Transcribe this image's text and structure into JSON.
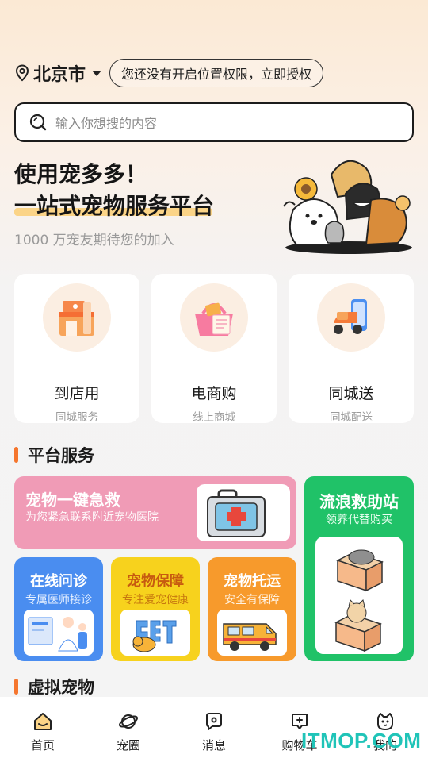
{
  "location": {
    "city": "北京市",
    "permission_notice": "您还没有开启位置权限，立即授权"
  },
  "search": {
    "placeholder": "输入你想搜的内容"
  },
  "hero": {
    "title_line1": "使用宠多多！",
    "title_line2": "一站式宠物服务平台",
    "subtitle": "1000 万宠友期待您的加入"
  },
  "features": [
    {
      "name": "到店用",
      "desc": "同城服务"
    },
    {
      "name": "电商购",
      "desc": "线上商城"
    },
    {
      "name": "同城送",
      "desc": "同城配送"
    }
  ],
  "sections": {
    "platform_services": "平台服务",
    "virtual_pets": "虚拟宠物"
  },
  "services": {
    "emergency": {
      "title": "宠物一键急救",
      "desc": "为您紧急联系附近宠物医院",
      "color": "#f09bb6"
    },
    "stray_rescue": {
      "title": "流浪救助站",
      "desc": "领养代替购买",
      "color": "#20c268"
    },
    "online_consult": {
      "title": "在线问诊",
      "desc": "专属医师接诊",
      "color": "#4a8df0"
    },
    "pet_insurance": {
      "title": "宠物保障",
      "desc": "专注爱宠健康",
      "color": "#f7d21d"
    },
    "pet_shipping": {
      "title": "宠物托运",
      "desc": "安全有保障",
      "color": "#f79a2c"
    }
  },
  "tabbar": [
    {
      "label": "首页",
      "icon": "home-icon"
    },
    {
      "label": "宠圈",
      "icon": "planet-icon"
    },
    {
      "label": "消息",
      "icon": "message-icon"
    },
    {
      "label": "购物车",
      "icon": "cart-icon"
    },
    {
      "label": "我的",
      "icon": "cat-face-icon"
    }
  ],
  "watermark": "ITMOP.COM",
  "colors": {
    "accent": "#f5762e",
    "highlight": "#fbd487"
  }
}
